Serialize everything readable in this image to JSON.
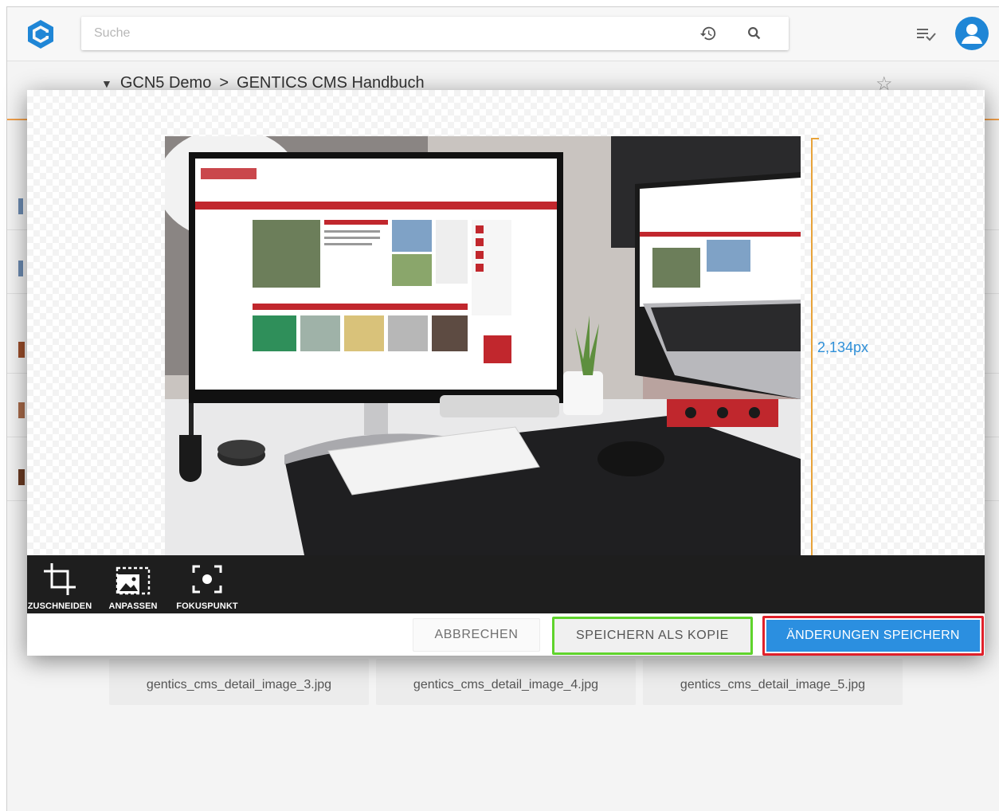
{
  "header": {
    "search_placeholder": "Suche",
    "icons": [
      "gcms-logo-icon",
      "history-icon",
      "search-icon",
      "task-list-icon",
      "user-avatar-icon"
    ]
  },
  "breadcrumb": {
    "root": "GCN5 Demo",
    "separator": ">",
    "current": "GENTICS CMS Handbuch"
  },
  "background_files": [
    {
      "name": "gentics_cms_detail_image_3.jpg"
    },
    {
      "name": "gentics_cms_detail_image_4.jpg"
    },
    {
      "name": "gentics_cms_detail_image_5.jpg"
    }
  ],
  "editor": {
    "height_label": "2,134px",
    "tools": [
      {
        "label": "ZUSCHNEIDEN",
        "icon": "crop-icon"
      },
      {
        "label": "ANPASSEN",
        "icon": "resize-icon"
      },
      {
        "label": "FOKUSPUNKT",
        "icon": "focal-point-icon"
      }
    ],
    "buttons": {
      "cancel": "ABBRECHEN",
      "save_copy": "SPEICHERN ALS KOPIE",
      "save": "ÄNDERUNGEN SPEICHERN"
    },
    "highlight_colors": {
      "save_copy": "#5fd32c",
      "save": "#e0202a"
    }
  },
  "colors": {
    "accent": "#2b8fe0",
    "dimension_line": "#e8a33a"
  }
}
